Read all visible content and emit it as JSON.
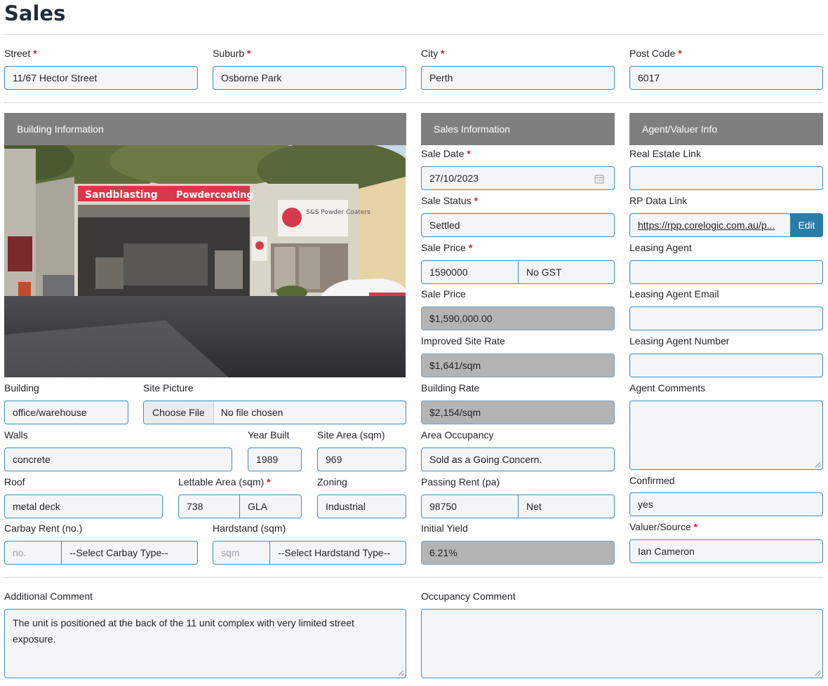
{
  "page": {
    "title": "Sales"
  },
  "address": {
    "street": {
      "label": "Street",
      "value": "11/67 Hector Street"
    },
    "suburb": {
      "label": "Suburb",
      "value": "Osborne Park"
    },
    "city": {
      "label": "City",
      "value": "Perth"
    },
    "postcode": {
      "label": "Post Code",
      "value": "6017"
    }
  },
  "required_mark": "*",
  "building": {
    "header": "Building Information",
    "photo_sign_main": "Sandblasting",
    "photo_sign_secondary": "Powdercoating",
    "photo_logo_text": "S&S Powder Coaters",
    "building": {
      "label": "Building",
      "value": "office/warehouse"
    },
    "site_picture": {
      "label": "Site Picture",
      "button": "Choose File",
      "status": "No file chosen"
    },
    "walls": {
      "label": "Walls",
      "value": "concrete"
    },
    "year_built": {
      "label": "Year Built",
      "value": "1989"
    },
    "site_area": {
      "label": "Site Area (sqm)",
      "value": "969"
    },
    "roof": {
      "label": "Roof",
      "value": "metal deck"
    },
    "lettable_area": {
      "label": "Lettable Area (sqm)",
      "value": "738",
      "unit": "GLA"
    },
    "zoning": {
      "label": "Zoning",
      "value": "Industrial"
    },
    "carbay": {
      "label": "Carbay Rent (no.)",
      "placeholder": "no.",
      "select": "--Select Carbay Type--"
    },
    "hardstand": {
      "label": "Hardstand (sqm)",
      "placeholder": "sqm",
      "select": "--Select Hardstand Type--"
    }
  },
  "sales": {
    "header": "Sales Information",
    "sale_date": {
      "label": "Sale Date",
      "value": "27/10/2023"
    },
    "sale_status": {
      "label": "Sale Status",
      "value": "Settled"
    },
    "sale_price": {
      "label": "Sale Price",
      "value": "1590000",
      "gst": "No GST"
    },
    "sale_price_formatted": {
      "label": "Sale Price",
      "value": "$1,590,000.00"
    },
    "improved_site_rate": {
      "label": "Improved Site Rate",
      "value": "$1,641/sqm"
    },
    "building_rate": {
      "label": "Building Rate",
      "value": "$2,154/sqm"
    },
    "area_occupancy": {
      "label": "Area Occupancy",
      "value": "Sold as a Going Concern."
    },
    "passing_rent": {
      "label": "Passing Rent (pa)",
      "value": "98750",
      "type": "Net"
    },
    "initial_yield": {
      "label": "Initial Yield",
      "value": "6.21%"
    }
  },
  "agent": {
    "header": "Agent/Valuer Info",
    "real_estate_link": {
      "label": "Real Estate Link",
      "value": ""
    },
    "rp_data_link": {
      "label": "RP Data Link",
      "value": "https://rpp.corelogic.com.au/p...",
      "button": "Edit"
    },
    "leasing_agent": {
      "label": "Leasing Agent",
      "value": ""
    },
    "leasing_agent_email": {
      "label": "Leasing Agent Email",
      "value": ""
    },
    "leasing_agent_number": {
      "label": "Leasing Agent Number",
      "value": ""
    },
    "agent_comments": {
      "label": "Agent Comments",
      "value": ""
    },
    "confirmed": {
      "label": "Confirmed",
      "value": "yes"
    },
    "valuer_source": {
      "label": "Valuer/Source",
      "value": "Ian Cameron"
    }
  },
  "comments": {
    "additional": {
      "label": "Additional Comment",
      "value": "The unit is positioned at the back of the 11 unit complex with very limited street exposure."
    },
    "occupancy": {
      "label": "Occupancy Comment",
      "value": ""
    }
  },
  "colors": {
    "accent": "#3a8fc4",
    "header_bg": "#7f7f7f",
    "required": "#d11a2a",
    "button": "#2b7ca6",
    "readonly_bg": "#b4b4b4"
  }
}
